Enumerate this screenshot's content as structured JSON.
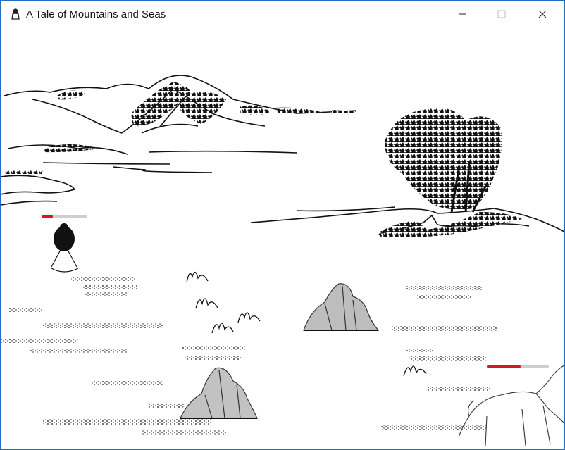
{
  "window": {
    "title": "A Tale of Mountains and Seas",
    "icon": "ink-figure-icon",
    "controls": {
      "minimize_icon": "minimize-icon",
      "maximize_icon": "maximize-icon",
      "close_icon": "close-icon"
    }
  },
  "game": {
    "player": {
      "health_fraction": 0.25
    },
    "enemy": {
      "health_fraction": 0.55
    },
    "colors": {
      "ink": "#111111",
      "health_fill": "#d11a1a",
      "health_track": "#cfcfcf",
      "window_border": "#1f6fc0"
    }
  }
}
